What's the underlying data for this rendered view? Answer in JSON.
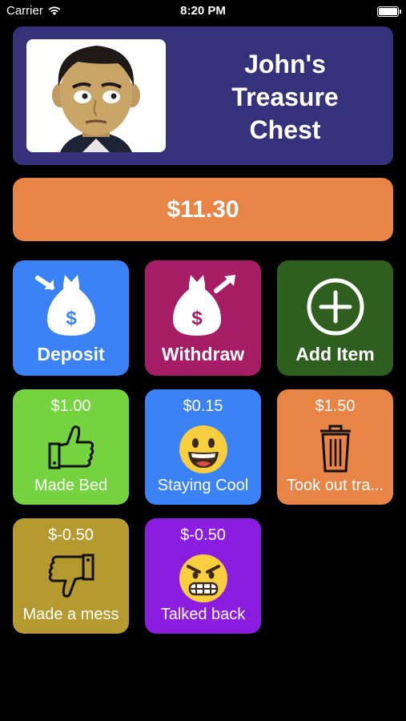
{
  "status_bar": {
    "carrier": "Carrier",
    "time": "8:20 PM"
  },
  "header": {
    "title": "John's\nTreasure\nChest"
  },
  "balance": {
    "amount": "$11.30"
  },
  "actions": [
    {
      "label": "Deposit",
      "color": "#3b82f6",
      "icon": "money-bag-deposit-icon"
    },
    {
      "label": "Withdraw",
      "color": "#a61d66",
      "icon": "money-bag-withdraw-icon"
    },
    {
      "label": "Add Item",
      "color": "#2f5f1f",
      "icon": "plus-circle-icon"
    }
  ],
  "items": [
    {
      "amount": "$1.00",
      "label": "Made Bed",
      "color": "#74d33f",
      "icon": "thumbs-up-icon"
    },
    {
      "amount": "$0.15",
      "label": "Staying Cool",
      "color": "#3b82f6",
      "icon": "grinning-face-icon"
    },
    {
      "amount": "$1.50",
      "label": "Took out tra...",
      "color": "#e98447",
      "icon": "trash-can-icon"
    },
    {
      "amount": "$-0.50",
      "label": "Made a mess",
      "color": "#b59a2f",
      "icon": "thumbs-down-icon"
    },
    {
      "amount": "$-0.50",
      "label": "Talked back",
      "color": "#8a1de0",
      "icon": "angry-face-icon"
    }
  ]
}
